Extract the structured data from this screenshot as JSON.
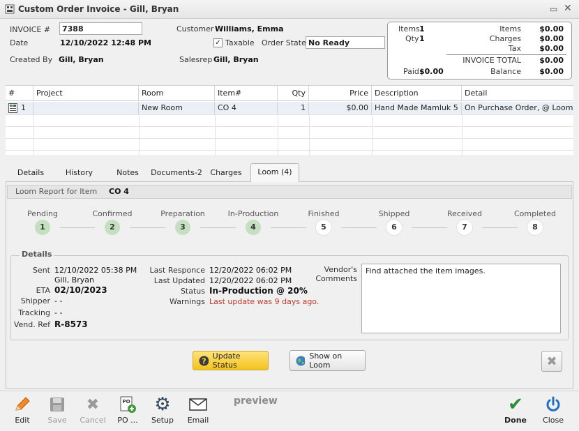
{
  "window": {
    "title": "Custom Order Invoice - Gill, Bryan"
  },
  "header": {
    "invoice_label": "INVOICE #",
    "invoice_value": "7388",
    "date_label": "Date",
    "date_value": "12/10/2022 12:48 PM",
    "created_by_label": "Created By",
    "created_by_value": "Gill, Bryan",
    "customer_label": "Customer",
    "customer_value": "Williams, Emma",
    "taxable_label": "Taxable",
    "taxable_checked": true,
    "order_state_label": "Order State",
    "order_state_value": "No Ready",
    "salesrep_label": "Salesrep",
    "salesrep_value": "Gill, Bryan"
  },
  "summary": {
    "items_label": "Items",
    "items_count": "1",
    "qty_label": "Qty",
    "qty_count": "1",
    "items_amount_label": "Items",
    "items_amount": "$0.00",
    "charges_label": "Charges",
    "charges_amount": "$0.00",
    "tax_label": "Tax",
    "tax_amount": "$0.00",
    "invoice_total_label": "INVOICE TOTAL",
    "invoice_total": "$0.00",
    "paid_label": "Paid",
    "paid_amount": "$0.00",
    "balance_label": "Balance",
    "balance_amount": "$0.00"
  },
  "grid": {
    "columns": [
      "#",
      "Project",
      "Room",
      "Item#",
      "Qty",
      "Price",
      "Description",
      "Detail"
    ],
    "rows": [
      {
        "num": "1",
        "project": "",
        "room": "New Room",
        "item": "CO 4",
        "qty": "1",
        "price": "$0.00",
        "description": "Hand Made Mamluk 5 ...",
        "detail": "On Purchase Order, @ Loom"
      }
    ]
  },
  "tabs": [
    "Details",
    "History",
    "Notes",
    "Documents-2",
    "Charges",
    "Loom (4)"
  ],
  "loom": {
    "report_label": "Loom Report for Item",
    "report_item": "CO 4",
    "steps": [
      {
        "label": "Pending",
        "num": "1",
        "done": true
      },
      {
        "label": "Confirmed",
        "num": "2",
        "done": true
      },
      {
        "label": "Preparation",
        "num": "3",
        "done": true
      },
      {
        "label": "In-Production",
        "num": "4",
        "done": true
      },
      {
        "label": "Finished",
        "num": "5",
        "done": false
      },
      {
        "label": "Shipped",
        "num": "6",
        "done": false
      },
      {
        "label": "Received",
        "num": "7",
        "done": false
      },
      {
        "label": "Completed",
        "num": "8",
        "done": false
      }
    ],
    "details_title": "Details",
    "sent_label": "Sent",
    "sent_value": "12/10/2022 05:38 PM",
    "sent_by": "Gill, Bryan",
    "eta_label": "ETA",
    "eta_value": "02/10/2023",
    "shipper_label": "Shipper",
    "shipper_value": "- -",
    "tracking_label": "Tracking",
    "tracking_value": "- -",
    "vendref_label": "Vend. Ref",
    "vendref_value": "R-8573",
    "last_response_label": "Last Responce",
    "last_response_value": "12/20/2022 06:02 PM",
    "last_updated_label": "Last Updated",
    "last_updated_value": "12/20/2022 06:02 PM",
    "status_label": "Status",
    "status_value": "In-Production @ 20%",
    "warnings_label": "Warnings",
    "warnings_value": "Last update was 9 days ago.",
    "vendor_comments_label_1": "Vendor's",
    "vendor_comments_label_2": "Comments",
    "vendor_comments_value": "Find attached the item images.",
    "update_status_label": "Update Status",
    "show_on_loom_label": "Show on Loom"
  },
  "toolbar": {
    "edit": "Edit",
    "save": "Save",
    "cancel": "Cancel",
    "po": "PO ...",
    "setup": "Setup",
    "email": "Email",
    "preview": "preview",
    "done": "Done",
    "close": "Close"
  },
  "colors": {
    "warning": "#c0392b",
    "done_step": "#c5e0c0",
    "accent_yellow": "#f3c31c",
    "done_check": "#2e8b3a",
    "close_blue": "#1f6fc0"
  }
}
